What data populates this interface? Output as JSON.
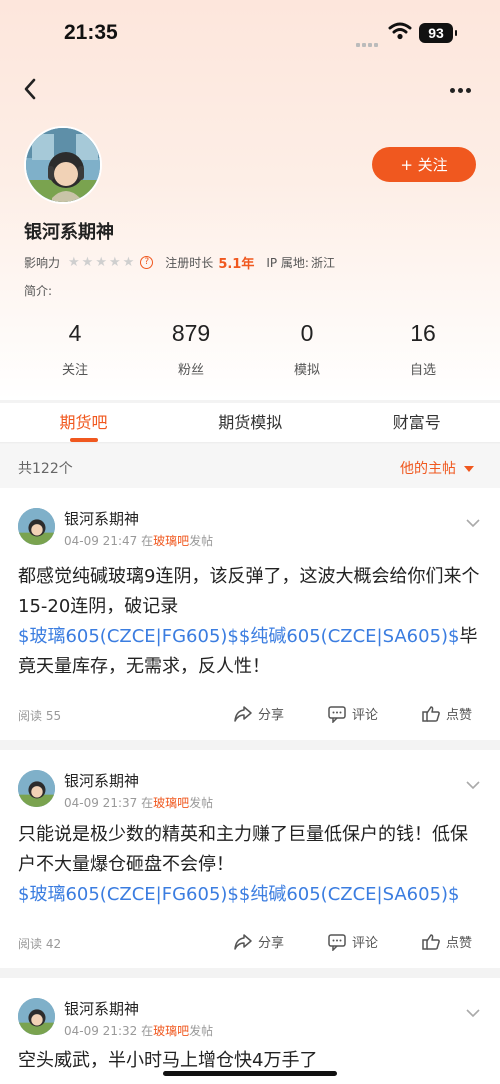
{
  "status_bar": {
    "time": "21:35",
    "battery": "93"
  },
  "profile": {
    "username": "银河系期神",
    "influence_label": "影响力",
    "register_label": "注册时长",
    "register_value": "5.1年",
    "ip_label": "IP 属地:",
    "ip_value": "浙江",
    "intro_label": "简介:",
    "follow_button": "+ 关注",
    "influence_stars": {
      "filled": 0,
      "total": 5
    }
  },
  "stats": [
    {
      "value": "4",
      "label": "关注"
    },
    {
      "value": "879",
      "label": "粉丝"
    },
    {
      "value": "0",
      "label": "模拟"
    },
    {
      "value": "16",
      "label": "自选"
    }
  ],
  "tabs": [
    "期货吧",
    "期货模拟",
    "财富号"
  ],
  "active_tab": 0,
  "list": {
    "count_label": "共122个",
    "filter_label": "他的主帖"
  },
  "posts": [
    {
      "author": "银河系期神",
      "time": "04-09 21:47",
      "prefix": "在",
      "bar": "玻璃吧",
      "suffix": "发帖",
      "text": "都感觉纯碱玻璃9连阴，该反弹了，这波大概会给你们来个15-20连阴，破记录",
      "tags": "$玻璃605(CZCE|FG605)$$纯碱605(CZCE|SA605)$",
      "tail": "毕竟天量库存，无需求，反人性！",
      "reads": "阅读 55",
      "share": "分享",
      "comment": "评论",
      "like": "点赞"
    },
    {
      "author": "银河系期神",
      "time": "04-09 21:37",
      "prefix": "在",
      "bar": "玻璃吧",
      "suffix": "发帖",
      "text": "只能说是极少数的精英和主力赚了巨量低保户的钱！低保户不大量爆仓砸盘不会停！",
      "tags": "$玻璃605(CZCE|FG605)$$纯碱605(CZCE|SA605)$",
      "tail": "",
      "reads": "阅读 42",
      "share": "分享",
      "comment": "评论",
      "like": "点赞"
    },
    {
      "author": "银河系期神",
      "time": "04-09 21:32",
      "prefix": "在",
      "bar": "玻璃吧",
      "suffix": "发帖",
      "text": "空头威武，半小时马上增仓快4万手了"
    }
  ],
  "icons": {
    "back": "chevron-left-icon",
    "more": "more-dots-icon",
    "share": "share-icon",
    "comment": "comment-icon",
    "like": "thumbs-up-icon",
    "post_menu": "chevron-down-icon"
  },
  "colors": {
    "accent": "#f0581f",
    "link": "#3b7de0"
  }
}
